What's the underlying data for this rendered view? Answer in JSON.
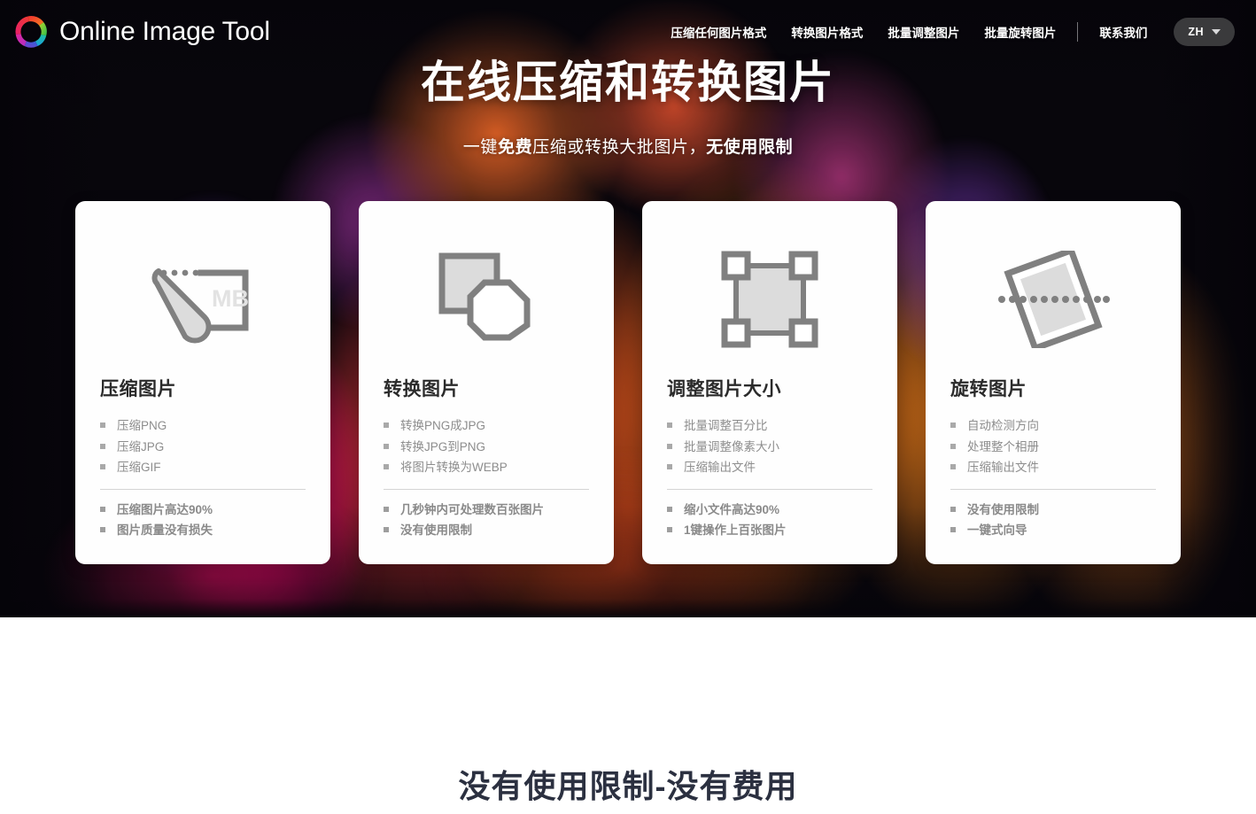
{
  "brand": {
    "name": "Online Image Tool",
    "logo_icon": "aperture-ring-icon"
  },
  "nav": {
    "items": [
      {
        "label": "压缩任何图片格式",
        "name": "nav-compress"
      },
      {
        "label": "转换图片格式",
        "name": "nav-convert"
      },
      {
        "label": "批量调整图片",
        "name": "nav-resize"
      },
      {
        "label": "批量旋转图片",
        "name": "nav-rotate"
      },
      {
        "label": "联系我们",
        "name": "nav-contact"
      }
    ],
    "language": {
      "label": "ZH",
      "caret_icon": "chevron-down-icon"
    }
  },
  "hero": {
    "title": "在线压缩和转换图片",
    "subtitle_parts": [
      {
        "text": "一键",
        "bold": false
      },
      {
        "text": "免费",
        "bold": true
      },
      {
        "text": "压缩或转换大批图片，",
        "bold": false
      },
      {
        "text": "无使用限制",
        "bold": true
      }
    ],
    "subtitle_plain": "一键免费压缩或转换大批图片，无使用限制"
  },
  "cards": [
    {
      "icon": "compress-mb-icon",
      "title": "压缩图片",
      "features": [
        "压缩PNG",
        "压缩JPG",
        "压缩GIF"
      ],
      "highlights": [
        "压缩图片高达90%",
        "图片质量没有损失"
      ]
    },
    {
      "icon": "convert-shapes-icon",
      "title": "转换图片",
      "features": [
        "转换PNG成JPG",
        "转换JPG到PNG",
        "将图片转换为WEBP"
      ],
      "highlights": [
        "几秒钟内可处理数百张图片",
        "没有使用限制"
      ]
    },
    {
      "icon": "resize-handles-icon",
      "title": "调整图片大小",
      "features": [
        "批量调整百分比",
        "批量调整像素大小",
        "压缩输出文件"
      ],
      "highlights": [
        "缩小文件高达90%",
        "1键操作上百张图片"
      ]
    },
    {
      "icon": "rotate-photo-icon",
      "title": "旋转图片",
      "features": [
        "自动检测方向",
        "处理整个相册",
        "压缩输出文件"
      ],
      "highlights": [
        "没有使用限制",
        "一键式向导"
      ]
    }
  ],
  "lower": {
    "heading": "没有使用限制-没有费用"
  },
  "colors": {
    "hero_background_base": "#07060b",
    "card_background": "#fefefe",
    "card_title": "#2b2b2b",
    "feature_text": "#8d8d8d",
    "lower_heading": "#2b3040",
    "lang_button_bg": "#3a3a3c",
    "icon_stroke": "#808080",
    "icon_fill": "#dcdcdc"
  }
}
